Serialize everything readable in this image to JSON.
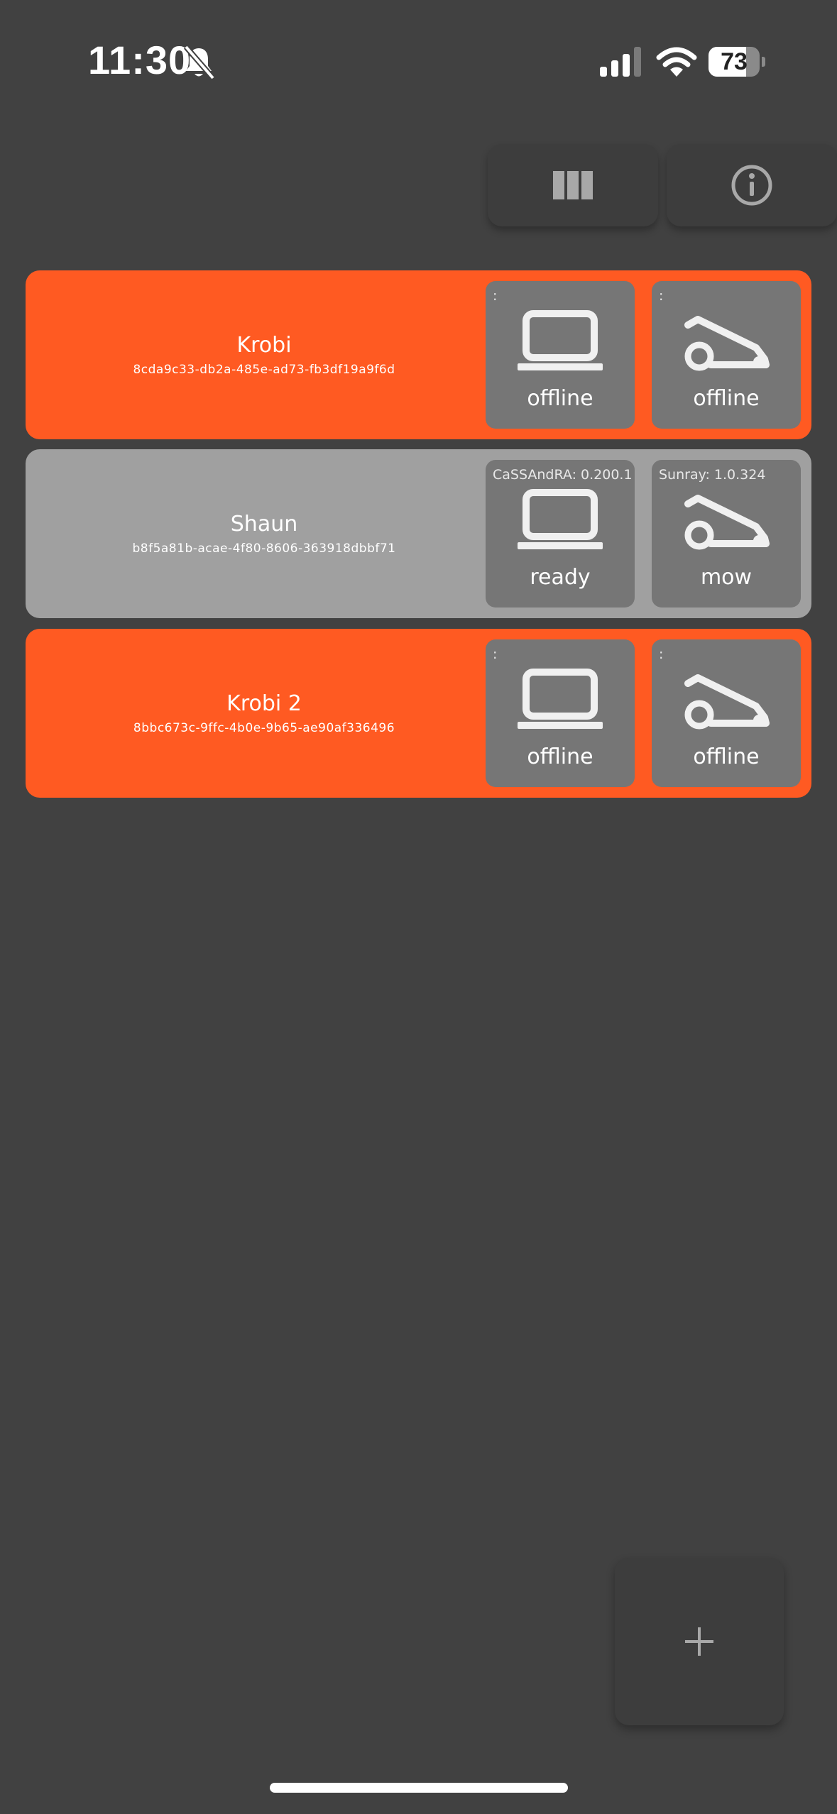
{
  "status_bar": {
    "time": "11:30",
    "battery_level": "73",
    "battery_fraction": 0.73
  },
  "toolbar": {
    "columns_icon": "columns-icon",
    "info_icon": "info-icon"
  },
  "devices": [
    {
      "name": "Krobi",
      "id": "8cda9c33-db2a-485e-ad73-fb3df19a9f6d",
      "state": "offline",
      "computer": {
        "version": ":",
        "status": "offline"
      },
      "mower": {
        "version": ":",
        "status": "offline"
      }
    },
    {
      "name": "Shaun",
      "id": "b8f5a81b-acae-4f80-8606-363918dbbf71",
      "state": "online",
      "computer": {
        "version": "CaSSAndRA: 0.200.1",
        "status": "ready"
      },
      "mower": {
        "version": "Sunray: 1.0.324",
        "status": "mow"
      }
    },
    {
      "name": "Krobi 2",
      "id": "8bbc673c-9ffc-4b0e-9b65-ae90af336496",
      "state": "offline",
      "computer": {
        "version": ":",
        "status": "offline"
      },
      "mower": {
        "version": ":",
        "status": "offline"
      }
    }
  ],
  "fab": {
    "icon": "plus-icon"
  },
  "colors": {
    "background": "#414141",
    "offline_card": "#ff5a22",
    "online_card": "#a0a0a0",
    "tile": "#767676",
    "button": "#3d3d3d"
  }
}
